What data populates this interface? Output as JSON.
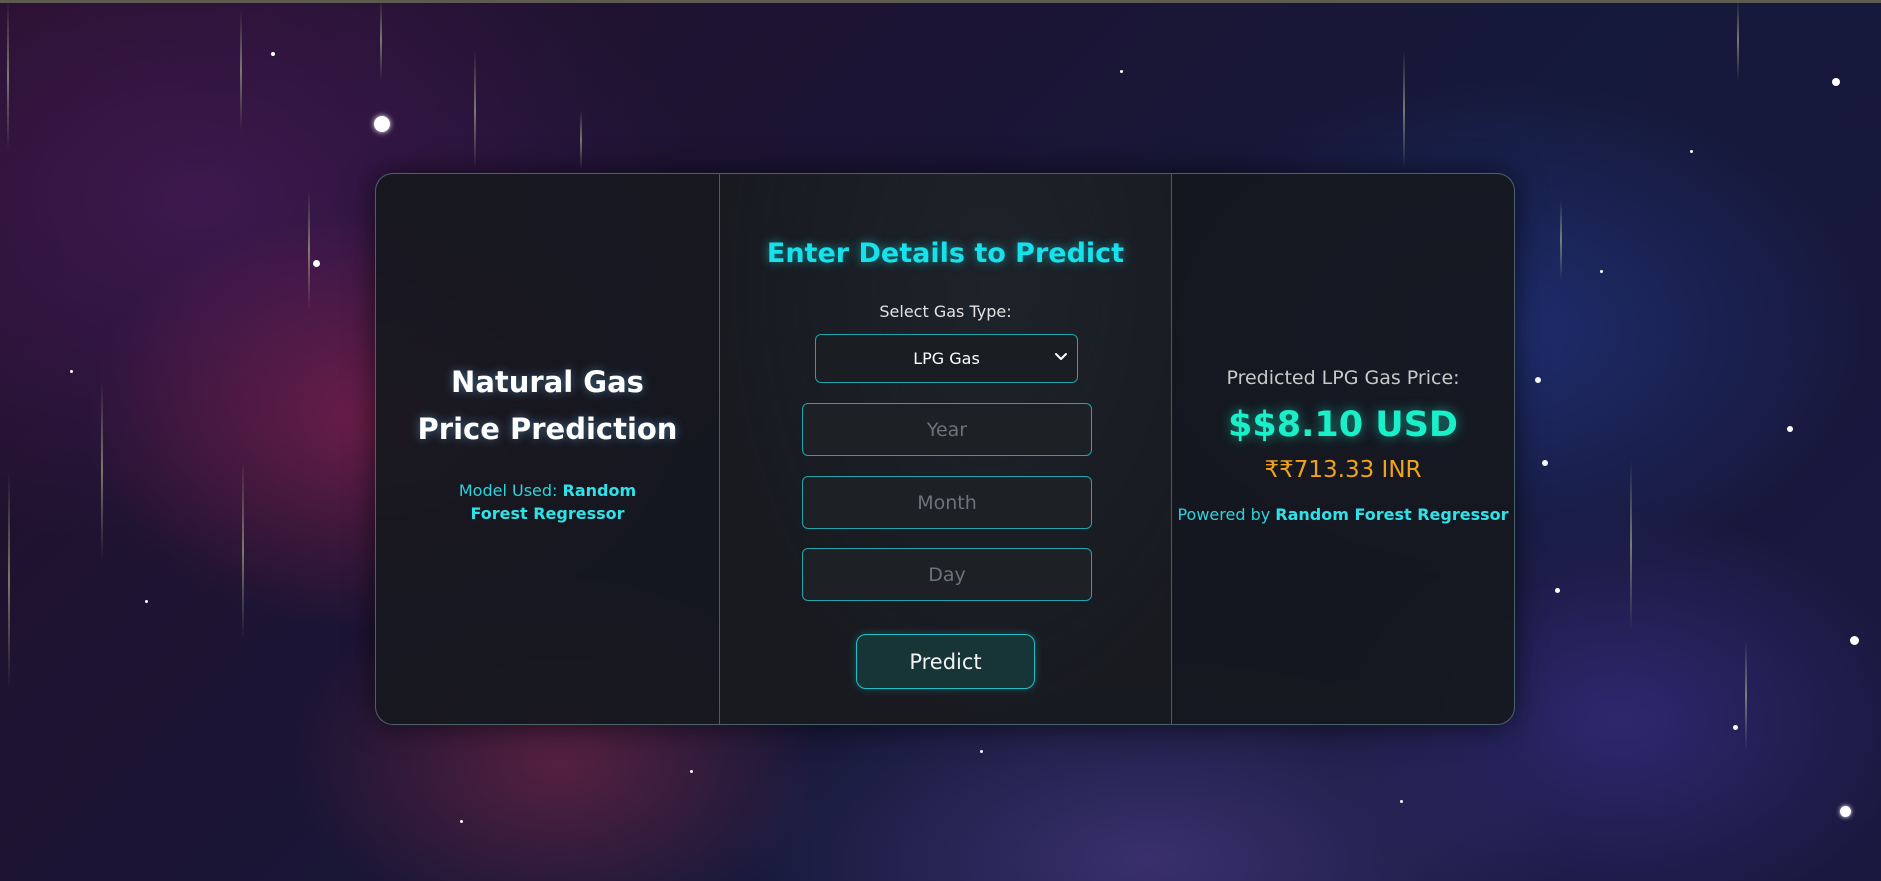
{
  "left": {
    "title_line1": "Natural Gas",
    "title_line2": "Price Prediction",
    "model_prefix": "Model Used: ",
    "model_name": "Random Forest Regressor"
  },
  "form": {
    "title": "Enter Details to Predict",
    "select_label": "Select Gas Type:",
    "gas_type_selected": "LPG Gas",
    "year_placeholder": "Year",
    "month_placeholder": "Month",
    "day_placeholder": "Day",
    "predict_label": "Predict"
  },
  "result": {
    "label": "Predicted LPG Gas Price:",
    "usd": "$$8.10 USD",
    "inr": "₹₹713.33 INR",
    "powered_prefix": "Powered by ",
    "powered_model": "Random Forest Regressor"
  },
  "colors": {
    "accent": "#16e2ec",
    "usd_price": "#19f0c9",
    "inr_price": "#f0a21a"
  },
  "icons": {
    "select_arrow": "chevron-down-icon"
  }
}
